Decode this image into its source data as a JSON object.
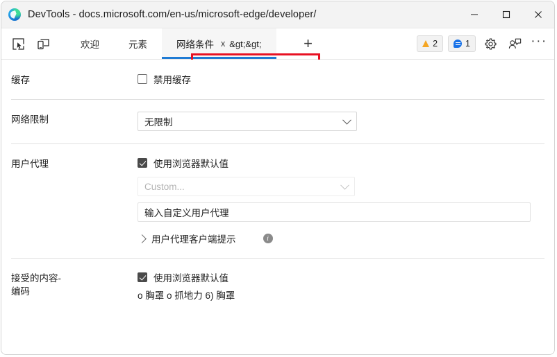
{
  "window": {
    "title": "DevTools - docs.microsoft.com/en-us/microsoft-edge/developer/",
    "app_icon": "edge-logo-icon",
    "controls": {
      "minimize": "minimize-icon",
      "maximize": "maximize-icon",
      "close": "close-icon"
    }
  },
  "toolbar": {
    "inspect_icon": "inspect-element-icon",
    "device_icon": "device-emulation-icon",
    "tabs": [
      {
        "label": "欢迎",
        "active": false
      },
      {
        "label": "元素",
        "active": false
      },
      {
        "label": "网络条件",
        "close": "x",
        "overflow": "&gt;&gt;",
        "active": true
      }
    ],
    "add_tab_label": "+",
    "warnings": {
      "icon": "warning-triangle-icon",
      "count": "2"
    },
    "issues": {
      "icon": "issues-speech-bubble-icon",
      "count": "1"
    },
    "settings_icon": "gear-icon",
    "feedback_icon": "feedback-icon",
    "more_icon": "more-options-icon",
    "more_label": "···"
  },
  "panel": {
    "cache": {
      "label": "缓存",
      "disable_cache_label": "禁用缓存",
      "disable_cache_checked": false
    },
    "throttling": {
      "label": "网络限制",
      "selected": "无限制"
    },
    "user_agent": {
      "label": "用户代理",
      "use_browser_default_label": "使用浏览器默认值",
      "use_browser_default_checked": true,
      "custom_select_placeholder": "Custom...",
      "custom_input_value": "输入自定义用户代理",
      "client_hints_label": "用户代理客户端提示",
      "info_glyph": "i",
      "expand_icon": "chevron-right-icon",
      "info_icon": "info-icon"
    },
    "content_encoding": {
      "label_line1": "接受的内容-",
      "label_line2": "编码",
      "use_browser_default_label": "使用浏览器默认值",
      "use_browser_default_checked": true,
      "options_text": "о 胸罩 о 抓地力 6) 胸罩"
    }
  },
  "colors": {
    "accent": "#1f7bd4",
    "highlight": "#e81123",
    "warning": "#f5a623",
    "issue": "#1a73e8"
  }
}
